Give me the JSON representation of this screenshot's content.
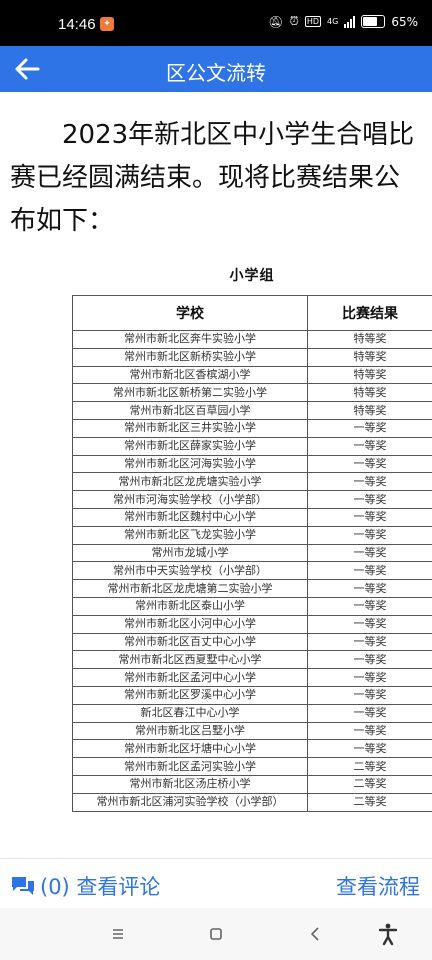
{
  "status": {
    "time": "14:46",
    "battery": "65%",
    "network": "4G"
  },
  "header": {
    "title": "区公文流转"
  },
  "intro": "2023年新北区中小学生合唱比赛已经圆满结束。现将比赛结果公布如下：",
  "doc": {
    "group_title": "小学组",
    "columns": [
      "学校",
      "比赛结果"
    ],
    "rows": [
      [
        "常州市新北区奔牛实验小学",
        "特等奖"
      ],
      [
        "常州市新北区新桥实验小学",
        "特等奖"
      ],
      [
        "常州市新北区香槟湖小学",
        "特等奖"
      ],
      [
        "常州市新北区新桥第二实验小学",
        "特等奖"
      ],
      [
        "常州市新北区百草园小学",
        "特等奖"
      ],
      [
        "常州市新北区三井实验小学",
        "一等奖"
      ],
      [
        "常州市新北区薛家实验小学",
        "一等奖"
      ],
      [
        "常州市新北区河海实验小学",
        "一等奖"
      ],
      [
        "常州市新北区龙虎塘实验小学",
        "一等奖"
      ],
      [
        "常州市河海实验学校（小学部）",
        "一等奖"
      ],
      [
        "常州市新北区魏村中心小学",
        "一等奖"
      ],
      [
        "常州市新北区飞龙实验小学",
        "一等奖"
      ],
      [
        "常州市龙城小学",
        "一等奖"
      ],
      [
        "常州市中天实验学校（小学部）",
        "一等奖"
      ],
      [
        "常州市新北区龙虎塘第二实验小学",
        "一等奖"
      ],
      [
        "常州市新北区泰山小学",
        "一等奖"
      ],
      [
        "常州市新北区小河中心小学",
        "一等奖"
      ],
      [
        "常州市新北区百丈中心小学",
        "一等奖"
      ],
      [
        "常州市新北区西夏墅中心小学",
        "一等奖"
      ],
      [
        "常州市新北区孟河中心小学",
        "一等奖"
      ],
      [
        "常州市新北区罗溪中心小学",
        "一等奖"
      ],
      [
        "新北区春江中心小学",
        "一等奖"
      ],
      [
        "常州市新北区吕墅小学",
        "一等奖"
      ],
      [
        "常州市新北区圩塘中心小学",
        "一等奖"
      ],
      [
        "常州市新北区孟河实验小学",
        "二等奖"
      ],
      [
        "常州市新北区汤庄桥小学",
        "二等奖"
      ],
      [
        "常州市新北区浦河实验学校（小学部）",
        "二等奖"
      ]
    ]
  },
  "footer": {
    "comments_label": "(0) 查看评论",
    "flow_label": "查看流程"
  },
  "colors": {
    "accent": "#2f74e6"
  },
  "icons": {
    "back": "arrow-left-icon",
    "comment": "comment-icon"
  }
}
